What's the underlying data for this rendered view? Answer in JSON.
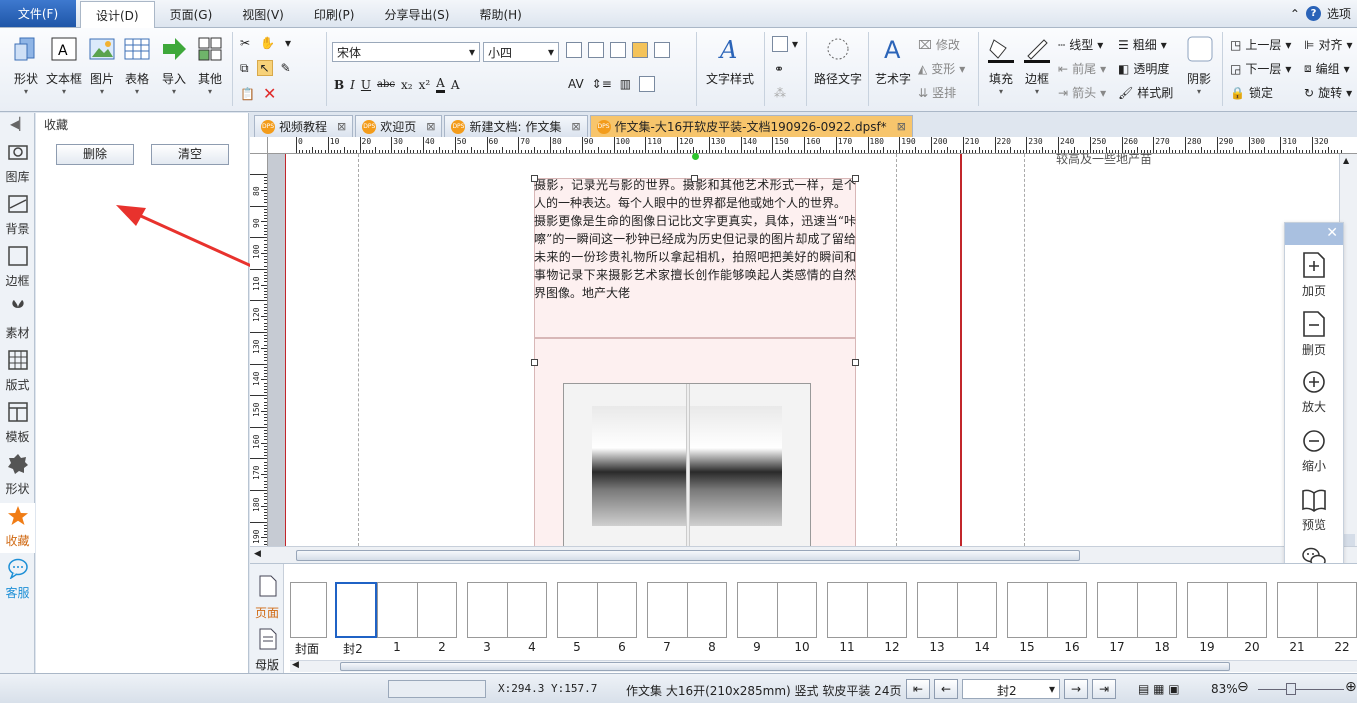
{
  "menu": {
    "file": "文件(F)",
    "items": [
      "设计(D)",
      "页面(G)",
      "视图(V)",
      "印刷(P)",
      "分享导出(S)",
      "帮助(H)"
    ],
    "active_index": 0,
    "options": "选项"
  },
  "ribbon": {
    "insert": [
      {
        "label": "形状",
        "icon": "shape-icon"
      },
      {
        "label": "文本框",
        "icon": "textbox-icon"
      },
      {
        "label": "图片",
        "icon": "image-icon"
      },
      {
        "label": "表格",
        "icon": "table-icon"
      },
      {
        "label": "导入",
        "icon": "import-icon"
      },
      {
        "label": "其他",
        "icon": "other-icon"
      }
    ],
    "font_name": "宋体",
    "font_size": "小四",
    "format_buttons": [
      "B",
      "I",
      "U",
      "abc",
      "x₂",
      "x²",
      "A",
      "A"
    ],
    "text_style": "文字样式",
    "path_text": "路径文字",
    "art_text": "艺术字",
    "art_small": [
      "修改",
      "变形",
      "竖排"
    ],
    "fill": "填充",
    "border": "边框",
    "line_small": [
      "线型",
      "前尾",
      "箭头"
    ],
    "weight_small": [
      "粗细",
      "透明度",
      "样式刷"
    ],
    "shadow": "阴影",
    "layer_small": [
      "上一层",
      "下一层",
      "锁定"
    ],
    "align_small": [
      "对齐",
      "编组",
      "旋转"
    ]
  },
  "leftbar": {
    "items": [
      {
        "label": "图库",
        "icon": "gallery-icon"
      },
      {
        "label": "背景",
        "icon": "background-icon"
      },
      {
        "label": "边框",
        "icon": "border-icon"
      },
      {
        "label": "素材",
        "icon": "material-icon"
      },
      {
        "label": "版式",
        "icon": "layout-icon"
      },
      {
        "label": "模板",
        "icon": "template-icon"
      },
      {
        "label": "形状",
        "icon": "shape-icon"
      },
      {
        "label": "收藏",
        "icon": "star-icon"
      },
      {
        "label": "客服",
        "icon": "chat-icon"
      }
    ],
    "active_index": 7
  },
  "panel": {
    "title": "收藏",
    "delete": "删除",
    "clear": "清空"
  },
  "tabs": [
    {
      "label": "视频教程",
      "active": false
    },
    {
      "label": "欢迎页",
      "active": false
    },
    {
      "label": "新建文档: 作文集",
      "active": false
    },
    {
      "label": "作文集-大16开软皮平装-文档190926-0922.dpsf*",
      "active": true
    }
  ],
  "ruler": {
    "h_labels": [
      "0",
      "10",
      "20",
      "30",
      "40",
      "50",
      "60",
      "70",
      "80",
      "90",
      "100",
      "110",
      "120",
      "130",
      "140",
      "150",
      "160",
      "170",
      "180",
      "190",
      "200",
      "210",
      "220",
      "230",
      "240",
      "250",
      "260",
      "270",
      "280",
      "290",
      "300",
      "310",
      "320"
    ],
    "v_labels": [
      "80",
      "90",
      "100",
      "110",
      "120",
      "130",
      "140",
      "150",
      "160",
      "170",
      "180",
      "190"
    ]
  },
  "document": {
    "paragraph1": "摄影，记录光与影的世界。摄影和其他艺术形式一样，是个人的一种表达。每个人眼中的世界都是他或她个人的世界。",
    "paragraph2": "摄影更像是生命的图像日记比文字更真实，具体，迅速当“咔嚓”的一瞬间这一秒钟已经成为历史但记录的图片却成了留给未来的一份珍贵礼物所以拿起相机，拍照吧把美好的瞬间和事物记录下来摄影艺术家擅长创作能够唤起人类感情的自然界图像。地产大佬",
    "corner_text": "较高及一些地产苗"
  },
  "floatpanel": {
    "items": [
      {
        "label": "加页",
        "icon": "add-page-icon"
      },
      {
        "label": "删页",
        "icon": "delete-page-icon"
      },
      {
        "label": "放大",
        "icon": "zoom-in-icon"
      },
      {
        "label": "缩小",
        "icon": "zoom-out-icon"
      },
      {
        "label": "预览",
        "icon": "preview-icon"
      },
      {
        "label": "分享",
        "icon": "wechat-icon"
      }
    ]
  },
  "strip": {
    "page_label": "页面",
    "master_label": "母版",
    "thumbs": [
      "封面",
      "封2",
      "1",
      "2",
      "3",
      "4",
      "5",
      "6",
      "7",
      "8",
      "9",
      "10",
      "11",
      "12",
      "13",
      "14",
      "15",
      "16",
      "17",
      "18",
      "19",
      "20",
      "21",
      "22"
    ],
    "selected": "封2"
  },
  "status": {
    "coords": "X:294.3  Y:157.7",
    "doc_info": "作文集 大16开(210x285mm) 竖式 软皮平装 24页",
    "current_page": "封2",
    "zoom": "83%"
  },
  "colors": {
    "accent": "#1f56a8",
    "tab_active": "#f7c56c",
    "arrow": "#e8322d",
    "page_tint": "#fdf0f0"
  }
}
